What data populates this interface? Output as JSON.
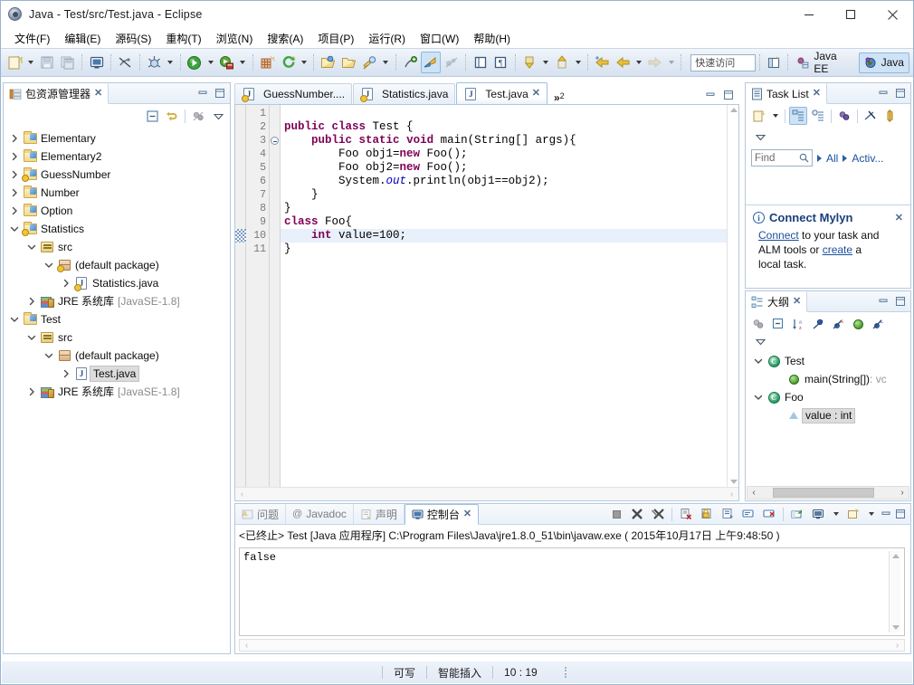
{
  "window": {
    "title": "Java - Test/src/Test.java - Eclipse",
    "app_icon": "eclipse-icon",
    "minimize": "minimize-icon",
    "maximize": "maximize-icon",
    "close": "close-icon"
  },
  "menubar": {
    "items": [
      {
        "label": "文件(F)",
        "mnemonic": "F"
      },
      {
        "label": "编辑(E)",
        "mnemonic": "E"
      },
      {
        "label": "源码(S)",
        "mnemonic": "S"
      },
      {
        "label": "重构(T)",
        "mnemonic": "T"
      },
      {
        "label": "浏览(N)",
        "mnemonic": "N"
      },
      {
        "label": "搜索(A)",
        "mnemonic": "A"
      },
      {
        "label": "项目(P)",
        "mnemonic": "P"
      },
      {
        "label": "运行(R)",
        "mnemonic": "R"
      },
      {
        "label": "窗口(W)",
        "mnemonic": "W"
      },
      {
        "label": "帮助(H)",
        "mnemonic": "H"
      }
    ]
  },
  "toolbar": {
    "quick_access_placeholder": "快速访问",
    "perspectives": [
      {
        "label": "Java EE",
        "active": false
      },
      {
        "label": "Java",
        "active": true
      }
    ],
    "buttons": [
      "new-wizard-icon",
      "new-wizard-dropdown",
      "save-icon",
      "save-all-icon",
      "print-icon",
      "toggle-breadcrumb-icon",
      "debug-icon",
      "debug-dropdown",
      "run-icon",
      "run-dropdown",
      "external-tools-icon",
      "external-tools-dropdown",
      "new-java-project-icon",
      "new-package-icon",
      "open-type-icon",
      "open-task-icon",
      "search-icon",
      "search-dropdown",
      "toggle-mark-occurrences-icon",
      "annotation-icon",
      "skip-breakpoints-icon",
      "open-perspective-icon",
      "previous-annotation-icon",
      "previous-dropdown",
      "next-annotation-icon",
      "next-dropdown",
      "back-icon",
      "back-dropdown",
      "forward-icon",
      "forward-dropdown"
    ]
  },
  "package_explorer": {
    "title": "包资源管理器",
    "close": "close-icon",
    "minimize": "minimize-icon",
    "maximize": "maximize-icon",
    "toolbar": [
      "collapse-all-icon",
      "link-with-editor-icon",
      "view-menu-icon",
      "view-dropdown-icon"
    ],
    "tree": [
      {
        "label": "Elementary",
        "depth": 0,
        "expanded": false,
        "icon": "project-folder-icon",
        "warning": false,
        "selected": false
      },
      {
        "label": "Elementary2",
        "depth": 0,
        "expanded": false,
        "icon": "project-folder-icon",
        "warning": false,
        "selected": false
      },
      {
        "label": "GuessNumber",
        "depth": 0,
        "expanded": false,
        "icon": "project-folder-icon",
        "warning": true,
        "selected": false
      },
      {
        "label": "Number",
        "depth": 0,
        "expanded": false,
        "icon": "project-folder-icon",
        "warning": false,
        "selected": false
      },
      {
        "label": "Option",
        "depth": 0,
        "expanded": false,
        "icon": "project-folder-icon",
        "warning": false,
        "selected": false
      },
      {
        "label": "Statistics",
        "depth": 0,
        "expanded": true,
        "icon": "project-folder-icon",
        "warning": true,
        "selected": false
      },
      {
        "label": "src",
        "depth": 1,
        "expanded": true,
        "icon": "source-folder-icon",
        "warning": false,
        "selected": false
      },
      {
        "label": "(default package)",
        "depth": 2,
        "expanded": true,
        "icon": "package-icon",
        "warning": true,
        "selected": false
      },
      {
        "label": "Statistics.java",
        "depth": 3,
        "expanded": false,
        "icon": "java-file-icon",
        "warning": true,
        "selected": false
      },
      {
        "label": "JRE 系统库",
        "sub": "[JavaSE-1.8]",
        "depth": 1,
        "expanded": false,
        "icon": "jre-library-icon",
        "warning": false,
        "selected": false
      },
      {
        "label": "Test",
        "depth": 0,
        "expanded": true,
        "icon": "project-folder-icon",
        "warning": false,
        "selected": false
      },
      {
        "label": "src",
        "depth": 1,
        "expanded": true,
        "icon": "source-folder-icon",
        "warning": false,
        "selected": false
      },
      {
        "label": "(default package)",
        "depth": 2,
        "expanded": true,
        "icon": "package-icon",
        "warning": false,
        "selected": false
      },
      {
        "label": "Test.java",
        "depth": 3,
        "expanded": false,
        "icon": "java-file-icon",
        "warning": false,
        "selected": true
      },
      {
        "label": "JRE 系统库",
        "sub": "[JavaSE-1.8]",
        "depth": 1,
        "expanded": false,
        "icon": "jre-library-icon",
        "warning": false,
        "selected": false
      }
    ]
  },
  "editor": {
    "tabs": [
      {
        "label": "GuessNumber....",
        "active": false,
        "icon": "java-file-icon",
        "warning": true,
        "closeable": false
      },
      {
        "label": "Statistics.java",
        "active": false,
        "icon": "java-file-icon",
        "warning": true,
        "closeable": false
      },
      {
        "label": "Test.java",
        "active": true,
        "icon": "java-file-icon",
        "warning": false,
        "closeable": true
      }
    ],
    "overflow_label": "»",
    "overflow_count": "2",
    "minimize": "minimize-icon",
    "maximize": "maximize-icon",
    "cursor_line": 10,
    "lines": [
      {
        "n": 1,
        "text": "",
        "fold": false,
        "highlight": false
      },
      {
        "n": 2,
        "text": "public class Test {",
        "fold": false,
        "highlight": false
      },
      {
        "n": 3,
        "text": "    public static void main(String[] args){",
        "fold": true,
        "highlight": false
      },
      {
        "n": 4,
        "text": "        Foo obj1=new Foo();",
        "fold": false,
        "highlight": false
      },
      {
        "n": 5,
        "text": "        Foo obj2=new Foo();",
        "fold": false,
        "highlight": false
      },
      {
        "n": 6,
        "text": "        System.out.println(obj1==obj2);",
        "fold": false,
        "highlight": false
      },
      {
        "n": 7,
        "text": "    }",
        "fold": false,
        "highlight": false
      },
      {
        "n": 8,
        "text": "}",
        "fold": false,
        "highlight": false
      },
      {
        "n": 9,
        "text": "class Foo{",
        "fold": false,
        "highlight": false
      },
      {
        "n": 10,
        "text": "    int value=100;",
        "fold": false,
        "highlight": true
      },
      {
        "n": 11,
        "text": "}",
        "fold": false,
        "highlight": false
      }
    ]
  },
  "task_list": {
    "title": "Task List",
    "close": "close-icon",
    "find_placeholder": "Find",
    "filter_all": "All",
    "filter_active": "Activ...",
    "toolbar": [
      "new-task-icon",
      "new-task-dropdown",
      "categorized-presentation-icon",
      "scheduled-presentation-icon",
      "focus-on-workweek-icon",
      "synchronize-icon",
      "collapse-all-icon",
      "view-menu-icon"
    ],
    "mylyn": {
      "heading": "Connect Mylyn",
      "close": "close-icon",
      "link1": "Connect",
      "text1": " to your task and",
      "text2": "ALM tools or ",
      "link2": "create",
      "text3": " a",
      "text4": "local task."
    }
  },
  "outline": {
    "title": "大纲",
    "close": "close-icon",
    "minimize": "minimize-icon",
    "maximize": "maximize-icon",
    "toolbar": [
      "focus-on-active-task-icon",
      "collapse-all-icon",
      "sort-icon",
      "hide-fields-icon",
      "hide-static-icon",
      "hide-nonpublic-icon",
      "hide-local-types-icon",
      "view-menu-icon"
    ],
    "tree": [
      {
        "label": "Test",
        "depth": 0,
        "expanded": true,
        "icon": "class-icon",
        "selected": false
      },
      {
        "label": "main(String[])",
        "sub": " : vc",
        "depth": 1,
        "expanded": false,
        "icon": "public-static-method-icon",
        "selected": false
      },
      {
        "label": "Foo",
        "depth": 0,
        "expanded": true,
        "icon": "class-default-icon",
        "selected": false
      },
      {
        "label": "value : int",
        "depth": 1,
        "expanded": false,
        "icon": "default-field-icon",
        "selected": true
      }
    ]
  },
  "console": {
    "tabs": [
      {
        "label": "问题",
        "active": false,
        "icon": "problems-icon"
      },
      {
        "label": "Javadoc",
        "active": false,
        "icon": "javadoc-icon"
      },
      {
        "label": "声明",
        "active": false,
        "icon": "declaration-icon"
      },
      {
        "label": "控制台",
        "active": true,
        "icon": "console-icon",
        "closeable": true
      }
    ],
    "toolbar": [
      "terminate-icon",
      "remove-launch-icon",
      "remove-all-launches-icon",
      "clear-console-icon",
      "scroll-lock-icon",
      "word-wrap-icon",
      "show-console-icon",
      "pin-console-icon",
      "display-selected-console-icon",
      "open-console-icon",
      "open-console-dropdown",
      "new-console-view-icon",
      "new-console-dropdown"
    ],
    "header": "<已终止> Test [Java 应用程序] C:\\Program Files\\Java\\jre1.8.0_51\\bin\\javaw.exe ( 2015年10月17日 上午9:48:50 )",
    "output": "false"
  },
  "statusbar": {
    "writable": "可写",
    "insert_mode": "智能插入",
    "position": "10 : 19"
  }
}
